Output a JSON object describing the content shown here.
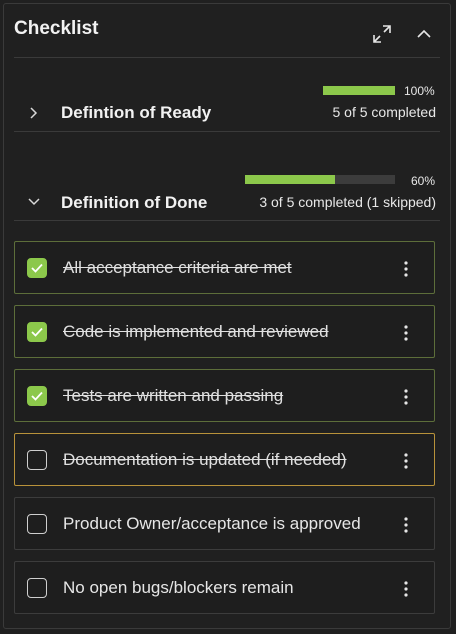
{
  "header": {
    "title": "Checklist",
    "expand_icon": "expand-diagonal-icon",
    "collapse_icon": "chevron-up-icon"
  },
  "sections": [
    {
      "title": "Defintion of Ready",
      "expanded": false,
      "percent": 100,
      "percent_label": "100%",
      "summary": "5 of 5 completed"
    },
    {
      "title": "Definition of Done",
      "expanded": true,
      "percent": 60,
      "percent_label": "60%",
      "summary": "3 of 5 completed (1 skipped)"
    }
  ],
  "items": [
    {
      "label": "All acceptance criteria are met",
      "state": "done"
    },
    {
      "label": "Code is implemented and reviewed",
      "state": "done"
    },
    {
      "label": "Tests are written and passing",
      "state": "done"
    },
    {
      "label": "Documentation is updated (if needed)",
      "state": "skipped"
    },
    {
      "label": "Product Owner/acceptance is approved",
      "state": "open"
    },
    {
      "label": "No open bugs/blockers remain",
      "state": "open"
    }
  ],
  "colors": {
    "accent_green": "#8cc84b",
    "skipped_border": "#b8923a",
    "background": "#202020"
  }
}
